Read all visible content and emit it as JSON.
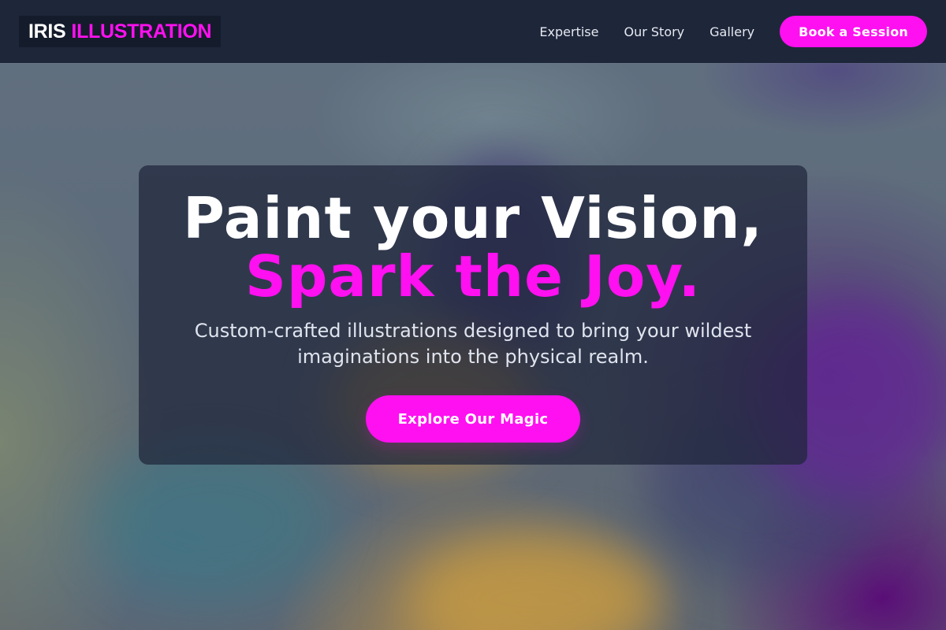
{
  "brand": {
    "name_part1": "IRIS",
    "name_part2": "ILLUSTRATION",
    "accent_color": "#ff10f0",
    "header_bg": "#1e263a"
  },
  "nav": {
    "links": [
      {
        "label": "Expertise"
      },
      {
        "label": "Our Story"
      },
      {
        "label": "Gallery"
      }
    ],
    "cta_label": "Book a Session"
  },
  "hero": {
    "headline_line1": "Paint your Vision,",
    "headline_line2": "Spark the Joy.",
    "subtitle": "Custom-crafted illustrations designed to bring your wildest imaginations into the physical realm.",
    "cta_label": "Explore Our Magic"
  }
}
